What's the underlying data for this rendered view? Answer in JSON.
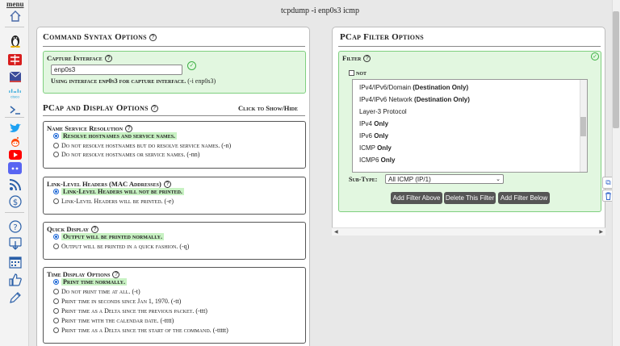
{
  "window": {
    "title": "tcpdump -i enp0s3 icmp"
  },
  "sidebar": {
    "menu_label": "menu",
    "icons": [
      "home-icon",
      "linux-icon",
      "redhat-icon",
      "mail-icon",
      "cisco-icon",
      "terminal-icon",
      "twitter-icon",
      "reddit-icon",
      "youtube-icon",
      "discord-icon",
      "rss-icon",
      "dollar-icon",
      "help-icon",
      "download-icon",
      "calendar-icon",
      "thumbs-up-icon",
      "pencil-icon"
    ]
  },
  "command_syntax": {
    "title": "Command Syntax Options",
    "capture_interface": {
      "title": "Capture Interface",
      "value": "enp0s3",
      "status_prefix": "Using interface enp0s3 for capture interface.",
      "status_flag": "(-i enp0s3)"
    }
  },
  "pcap_display": {
    "title": "PCap and Display Options",
    "toggle_label": "Click to Show/Hide",
    "name_service": {
      "title": "Name Service Resolution",
      "options": [
        {
          "label": "Resolve hostnames and service names.",
          "flag": ""
        },
        {
          "label": "Do not resolve hostnames but do resolve service names.",
          "flag": "(-n)"
        },
        {
          "label": "Do not resolve hostnames or service names.",
          "flag": "(-nn)"
        }
      ]
    },
    "link_level": {
      "title": "Link-Level Headers (MAC Addresses)",
      "options": [
        {
          "label": "Link-Level Headers will not be printed.",
          "flag": ""
        },
        {
          "label": "Link-Level Headers will be printed.",
          "flag": "(-e)"
        }
      ]
    },
    "quick_display": {
      "title": "Quick Display",
      "options": [
        {
          "label": "Output will be printed normally.",
          "flag": ""
        },
        {
          "label": "Output will be printed in a quick fashion.",
          "flag": "(-q)"
        }
      ]
    },
    "time_display": {
      "title": "Time Display Options",
      "options": [
        {
          "label": "Print time normally.",
          "flag": ""
        },
        {
          "label": "Do not print time at all.",
          "flag": "(-t)"
        },
        {
          "label": "Print time in seconds since Jan 1, 1970.",
          "flag": "(-tt)"
        },
        {
          "label": "Print time as a Delta since the previous packet.",
          "flag": "(-ttt)"
        },
        {
          "label": "Print time with the calendar date.",
          "flag": "(-tttt)"
        },
        {
          "label": "Print time as a Delta since the start of the command.",
          "flag": "(-ttttt)"
        }
      ]
    }
  },
  "pcap_filter": {
    "title": "PCap Filter Options",
    "filter": {
      "title": "Filter",
      "not_label": "not",
      "list_items": [
        {
          "text": "IPv4/IPv6/Domain ",
          "bold": "(Destination Only)"
        },
        {
          "text": "IPv4/IPv6 Network ",
          "bold": "(Destination Only)"
        },
        {
          "text": "Layer-3 Protocol",
          "bold": ""
        },
        {
          "text": "IPv4 ",
          "bold": "Only"
        },
        {
          "text": "IPv6 ",
          "bold": "Only"
        },
        {
          "text": "ICMP ",
          "bold": "Only"
        },
        {
          "text": "ICMP6 ",
          "bold": "Only"
        }
      ],
      "subtype_label": "Sub-Type:",
      "subtype_value": "All ICMP (IP/1)",
      "buttons": {
        "add_above": "Add Filter Above",
        "delete": "Delete This Filter",
        "add_below": "Add Filter Below"
      }
    }
  },
  "floating_tools": {
    "icons": [
      "copy-icon",
      "trash-icon"
    ]
  }
}
